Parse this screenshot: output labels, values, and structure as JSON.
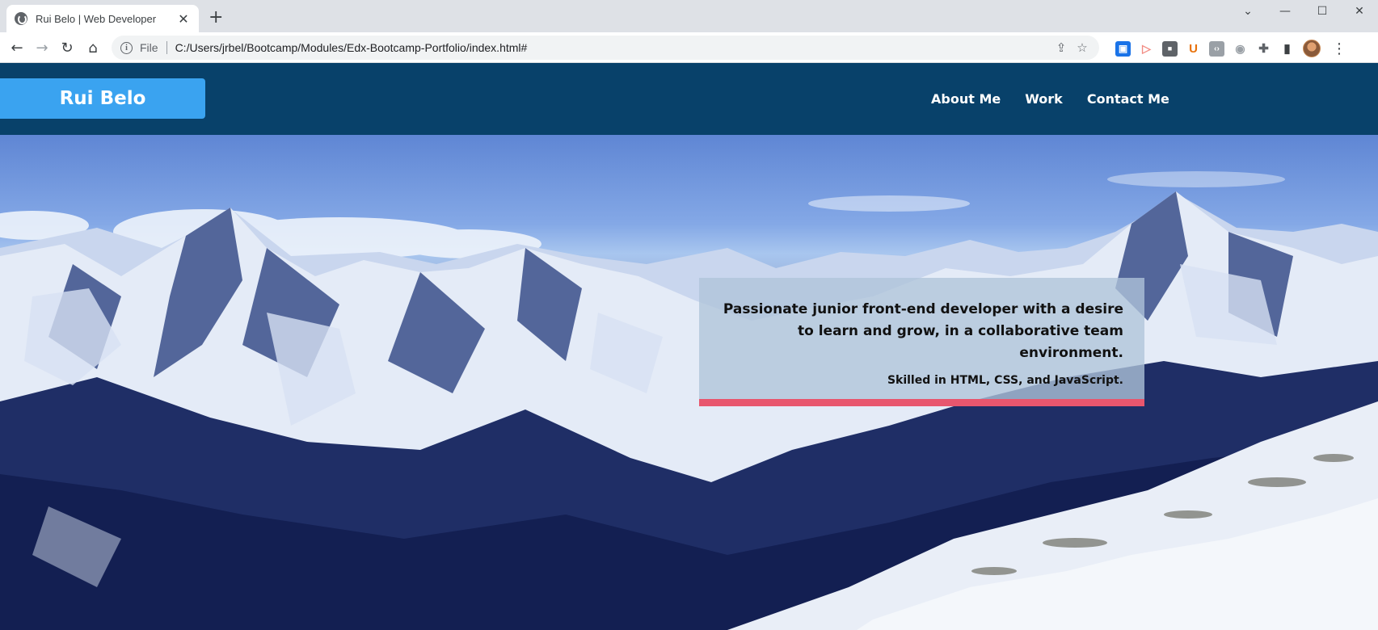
{
  "browser": {
    "tab_title": "Rui Belo | Web Developer",
    "tab_close": "✕",
    "new_tab": "+",
    "controls": {
      "minimize": "—",
      "maximize": "☐",
      "close": "✕",
      "tab_search": "⌄"
    },
    "nav": {
      "back": "←",
      "forward": "→",
      "reload": "↻",
      "home": "⌂"
    },
    "address_scheme_label": "File",
    "url": "C:/Users/jrbel/Bootcamp/Modules/Edx-Bootcamp-Portfolio/index.html#",
    "extensions": [
      {
        "icon": "screenshot-extension-icon",
        "glyph": "▣",
        "color": "#1a73e8"
      },
      {
        "icon": "screen-recorder-icon",
        "glyph": "▷",
        "color": "#f28b82"
      },
      {
        "icon": "profile-extension-icon",
        "glyph": "■",
        "color": "#5f6368"
      },
      {
        "icon": "ublock-icon",
        "glyph": "U",
        "color": "#e8710a"
      },
      {
        "icon": "code-viewer-icon",
        "glyph": "‹›",
        "color": "#9aa0a6"
      },
      {
        "icon": "camera-icon",
        "glyph": "◉",
        "color": "#9aa0a6"
      },
      {
        "icon": "puzzle-icon",
        "glyph": "✚",
        "color": "#5f6368"
      },
      {
        "icon": "side-panel-icon",
        "glyph": "▮",
        "color": "#3c4043"
      }
    ],
    "menu": "⋮"
  },
  "site": {
    "brand": "Rui Belo",
    "nav": [
      {
        "label": "About Me"
      },
      {
        "label": "Work"
      },
      {
        "label": "Contact Me"
      }
    ],
    "intro": {
      "headline": "Passionate junior front-end developer with a desire to learn and grow, in a collaborative team environment.",
      "skills": "Skilled in HTML, CSS, and JavaScript."
    }
  },
  "colors": {
    "header_bg": "#08416a",
    "brand_bg": "#3aa3f0",
    "intro_accent": "#e8566e"
  }
}
